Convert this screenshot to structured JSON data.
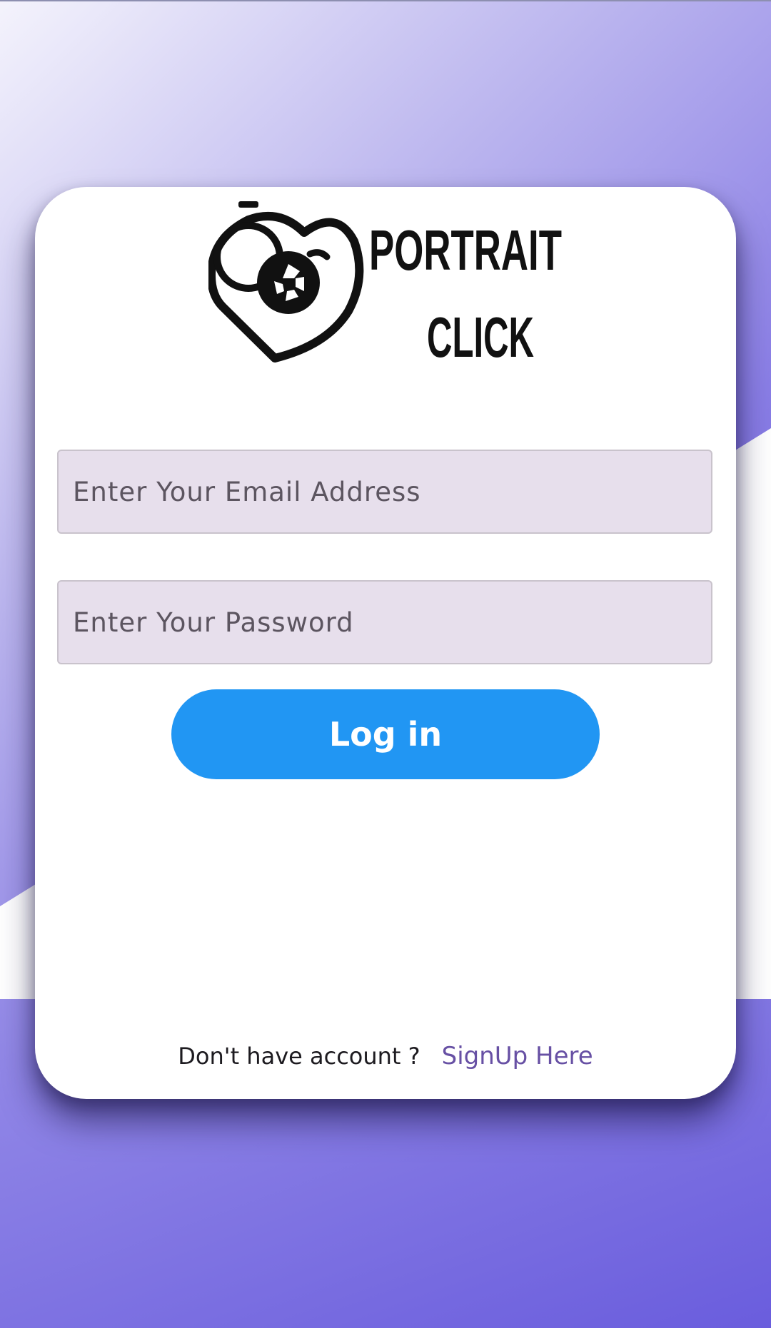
{
  "brand": {
    "line1": "PORTRAIT",
    "line2": "CLICK",
    "logo_icon": "heart-camera-icon"
  },
  "login_form": {
    "email_placeholder": "Enter Your Email Address",
    "email_value": "",
    "password_placeholder": "Enter Your Password",
    "password_value": "",
    "login_label": "Log in"
  },
  "signup": {
    "prompt": "Don't have account ?",
    "link_label": "SignUp Here"
  },
  "colors": {
    "accent_button": "#2196f3",
    "link": "#6750a4",
    "field_fill": "#e7dfec",
    "background_purple": "#6a5ddd"
  }
}
